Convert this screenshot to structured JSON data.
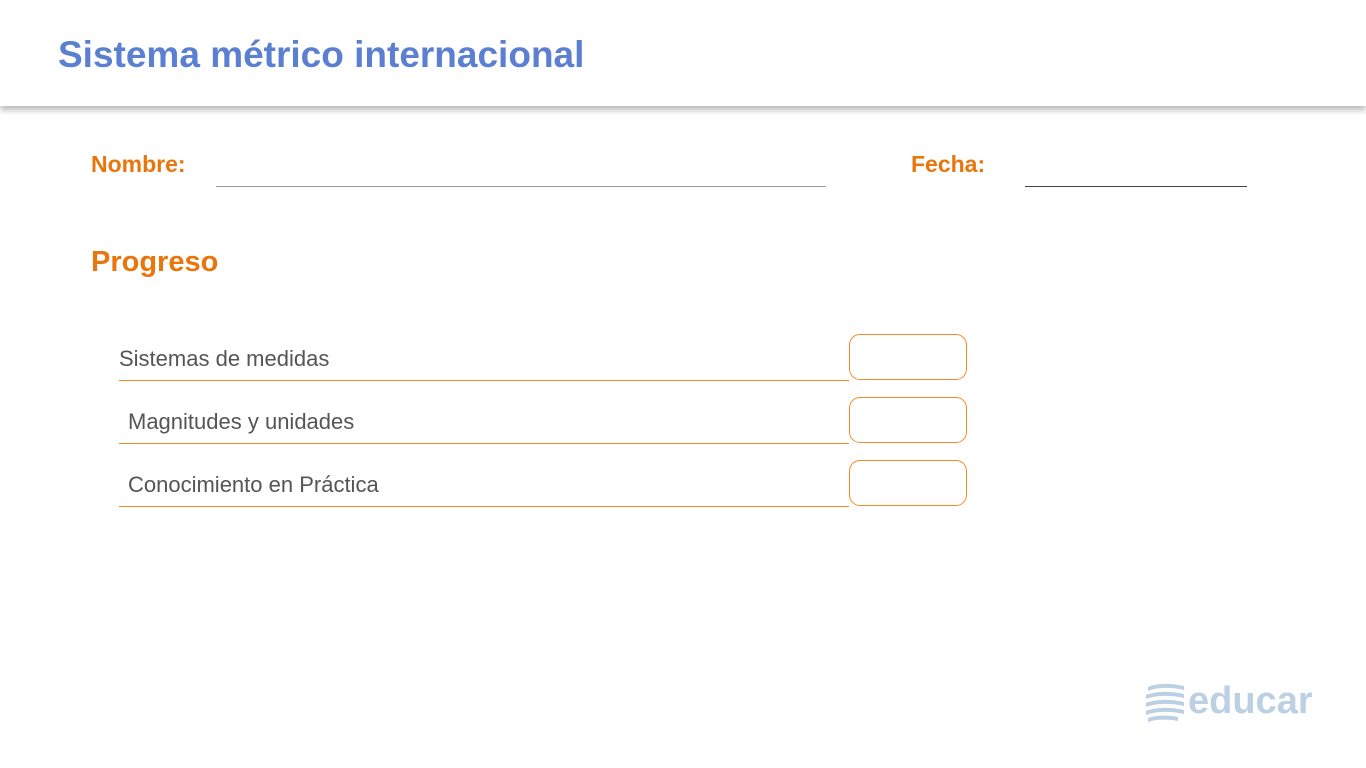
{
  "header": {
    "title": "Sistema métrico internacional"
  },
  "form": {
    "name_label": "Nombre:",
    "date_label": "Fecha:"
  },
  "progress": {
    "title": "Progreso",
    "items": [
      {
        "label": "Sistemas de medidas"
      },
      {
        "label": "Magnitudes y unidades"
      },
      {
        "label": "Conocimiento en Práctica"
      }
    ]
  },
  "logo": {
    "text": "educar",
    "icon": "stacked-pages-icon"
  },
  "colors": {
    "title": "#5b7fd1",
    "accent": "#e8760c",
    "line_accent": "#f28a2a",
    "logo": "#bcd0e4"
  }
}
